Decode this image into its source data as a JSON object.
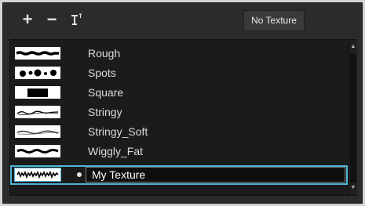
{
  "toolbar": {
    "add_icon": "plus-icon",
    "remove_icon": "minus-icon",
    "rename_icon": "rename-icon",
    "no_texture_label": "No Texture"
  },
  "textures": [
    {
      "label": "Rough",
      "selected": false
    },
    {
      "label": "Spots",
      "selected": false
    },
    {
      "label": "Square",
      "selected": false
    },
    {
      "label": "Stringy",
      "selected": false
    },
    {
      "label": "Stringy_Soft",
      "selected": false
    },
    {
      "label": "Wiggly_Fat",
      "selected": false
    },
    {
      "label": "My Texture",
      "selected": true
    }
  ],
  "colors": {
    "panel_bg": "#2b2b2b",
    "list_bg": "#1b1b1b",
    "selection_outline": "#4db6d6",
    "text": "#dcdcdc"
  }
}
